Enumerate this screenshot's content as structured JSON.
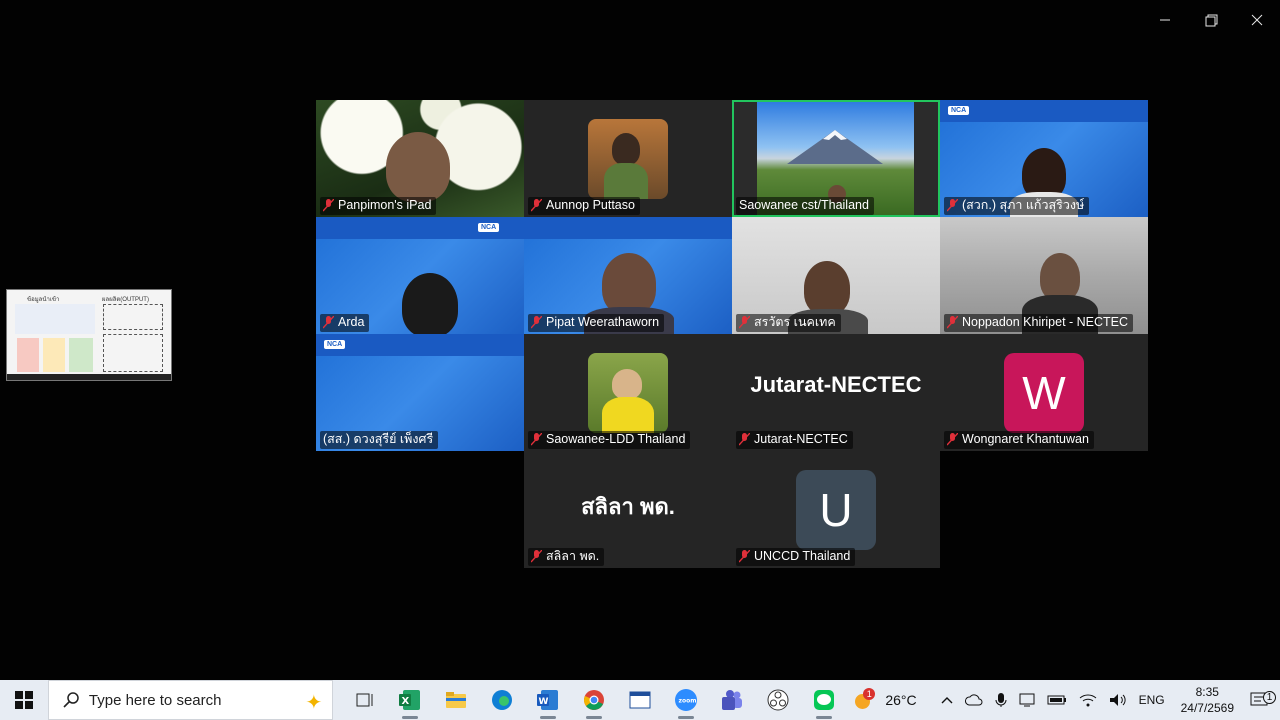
{
  "window_controls": {
    "minimize": "—",
    "restore": "❐",
    "close": "✕"
  },
  "shared_screen": {
    "title_left": "ข้อมูลนำเข้า",
    "title_right": "ผลผลิต(OUTPUT)"
  },
  "participants": [
    {
      "name": "Panpimon's iPad",
      "muted": true
    },
    {
      "name": "Aunnop Puttaso",
      "muted": true
    },
    {
      "name": "Saowanee cst/Thailand",
      "muted": false,
      "active_speaker": true
    },
    {
      "name": "(สวก.) สุภา แก้วสุริวงษ์",
      "muted": true
    },
    {
      "name": "Arda",
      "muted": true
    },
    {
      "name": "Pipat Weerathaworn",
      "muted": true
    },
    {
      "name": "สรวัตร เนคเทค",
      "muted": true
    },
    {
      "name": "Noppadon Khiripet - NECTEC",
      "muted": true
    },
    {
      "name": "(สส.) ดวงสุรีย์ เพ็งศรี",
      "muted": false
    },
    {
      "name": "Saowanee-LDD Thailand",
      "muted": true
    },
    {
      "name": "Jutarat-NECTEC",
      "muted": true,
      "display_text": "Jutarat-NECTEC"
    },
    {
      "name": "Wongnaret Khantuwan",
      "muted": true,
      "avatar_letter": "W",
      "avatar_color": "#c8165a"
    },
    {
      "name": "สลิลา พด.",
      "muted": true,
      "display_text": "สลิลา พด."
    },
    {
      "name": "UNCCD Thailand",
      "muted": true,
      "avatar_letter": "U",
      "avatar_color": "#3c4a57"
    }
  ],
  "taskbar": {
    "search_placeholder": "Type here to search",
    "apps": [
      "task-view",
      "excel",
      "file-explorer",
      "edge",
      "word",
      "chrome",
      "app-window",
      "zoom",
      "teams",
      "obs",
      "line"
    ],
    "weather": {
      "temp": "26°C",
      "badge": "1"
    },
    "language": "ENG",
    "time": "8:35",
    "date": "24/7/2569",
    "notification_count": "1"
  },
  "colors": {
    "active_speaker": "#22c55e",
    "muted_icon": "#e0303a",
    "taskbar_bg": "#e7ecf3"
  }
}
